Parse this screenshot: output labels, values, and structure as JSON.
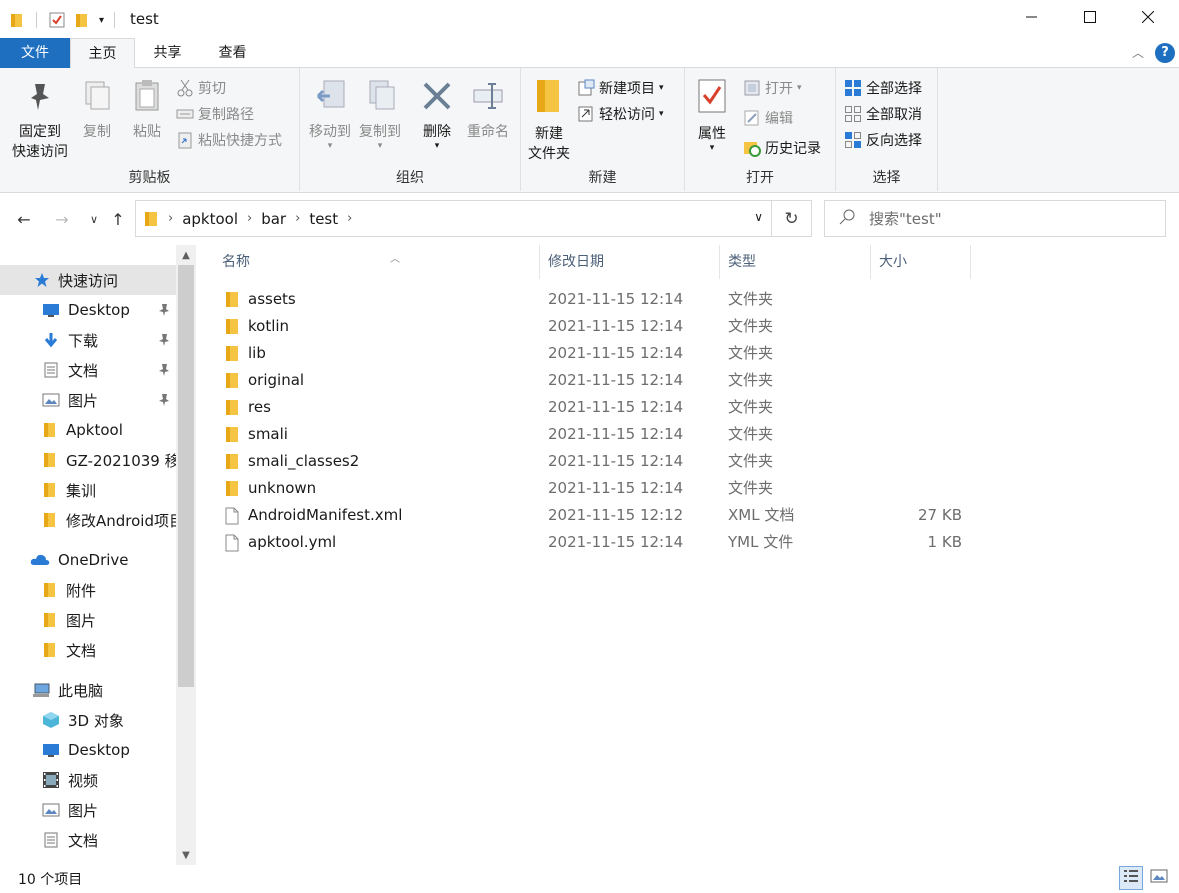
{
  "window": {
    "title": "test",
    "minimize_icon": "minimize-icon",
    "maximize_icon": "maximize-icon",
    "close_icon": "close-icon"
  },
  "ribbon_tabs": [
    "文件",
    "主页",
    "共享",
    "查看"
  ],
  "ribbon": {
    "clipboard": {
      "label": "剪贴板",
      "pin_quick_access": [
        "固定到",
        "快速访问"
      ],
      "copy": "复制",
      "paste": "粘贴",
      "cut": "剪切",
      "copy_path": "复制路径",
      "paste_shortcut": "粘贴快捷方式"
    },
    "organize": {
      "label": "组织",
      "move_to": "移动到",
      "copy_to": "复制到",
      "delete": "删除",
      "rename": "重命名"
    },
    "new": {
      "label": "新建",
      "new_folder": [
        "新建",
        "文件夹"
      ],
      "new_item": "新建项目",
      "easy_access": "轻松访问"
    },
    "open": {
      "label": "打开",
      "properties": "属性",
      "open": "打开",
      "edit": "编辑",
      "history": "历史记录"
    },
    "select": {
      "label": "选择",
      "select_all": "全部选择",
      "select_none": "全部取消",
      "invert": "反向选择"
    }
  },
  "address": {
    "breadcrumbs": [
      "apktool",
      "bar",
      "test"
    ],
    "search_placeholder": "搜索\"test\""
  },
  "nav_pane": {
    "quick_access": "快速访问",
    "quick_items": [
      {
        "label": "Desktop",
        "pinned": true,
        "icon": "desktop-icon"
      },
      {
        "label": "下载",
        "pinned": true,
        "icon": "download-icon"
      },
      {
        "label": "文档",
        "pinned": true,
        "icon": "documents-icon"
      },
      {
        "label": "图片",
        "pinned": true,
        "icon": "pictures-icon"
      },
      {
        "label": "Apktool",
        "pinned": false,
        "icon": "folder-icon"
      },
      {
        "label": "GZ-2021039 移",
        "pinned": false,
        "icon": "folder-icon"
      },
      {
        "label": "集训",
        "pinned": false,
        "icon": "folder-icon"
      },
      {
        "label": "修改Android项目",
        "pinned": false,
        "icon": "folder-icon"
      }
    ],
    "onedrive": "OneDrive",
    "onedrive_items": [
      "附件",
      "图片",
      "文档"
    ],
    "this_pc": "此电脑",
    "pc_items": [
      {
        "label": "3D 对象",
        "icon": "3d-objects-icon"
      },
      {
        "label": "Desktop",
        "icon": "desktop-icon"
      },
      {
        "label": "视频",
        "icon": "videos-icon"
      },
      {
        "label": "图片",
        "icon": "pictures-icon"
      },
      {
        "label": "文档",
        "icon": "documents-icon"
      }
    ]
  },
  "columns": [
    "名称",
    "修改日期",
    "类型",
    "大小"
  ],
  "files": [
    {
      "name": "assets",
      "date": "2021-11-15 12:14",
      "type": "文件夹",
      "size": "",
      "kind": "folder"
    },
    {
      "name": "kotlin",
      "date": "2021-11-15 12:14",
      "type": "文件夹",
      "size": "",
      "kind": "folder"
    },
    {
      "name": "lib",
      "date": "2021-11-15 12:14",
      "type": "文件夹",
      "size": "",
      "kind": "folder"
    },
    {
      "name": "original",
      "date": "2021-11-15 12:14",
      "type": "文件夹",
      "size": "",
      "kind": "folder"
    },
    {
      "name": "res",
      "date": "2021-11-15 12:14",
      "type": "文件夹",
      "size": "",
      "kind": "folder"
    },
    {
      "name": "smali",
      "date": "2021-11-15 12:14",
      "type": "文件夹",
      "size": "",
      "kind": "folder"
    },
    {
      "name": "smali_classes2",
      "date": "2021-11-15 12:14",
      "type": "文件夹",
      "size": "",
      "kind": "folder"
    },
    {
      "name": "unknown",
      "date": "2021-11-15 12:14",
      "type": "文件夹",
      "size": "",
      "kind": "folder"
    },
    {
      "name": "AndroidManifest.xml",
      "date": "2021-11-15 12:12",
      "type": "XML 文档",
      "size": "27 KB",
      "kind": "file"
    },
    {
      "name": "apktool.yml",
      "date": "2021-11-15 12:14",
      "type": "YML 文件",
      "size": "1 KB",
      "kind": "file"
    }
  ],
  "status": {
    "item_count": "10 个项目"
  },
  "colors": {
    "accent": "#1e6fbf",
    "folder": "#f6c443",
    "selection": "#e5e5e5"
  }
}
